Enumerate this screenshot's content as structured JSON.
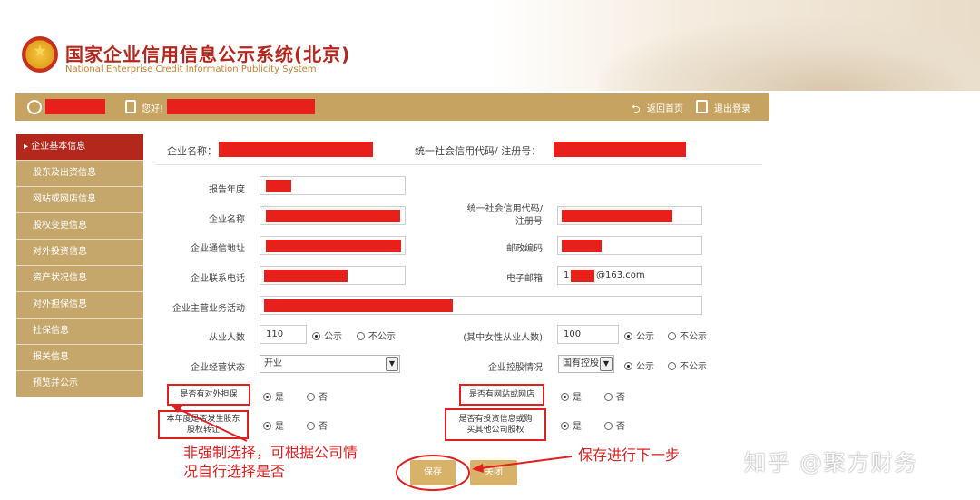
{
  "header": {
    "title": "国家企业信用信息公示系统(北京)",
    "subtitle": "National Enterprise Credit Information Publicity System"
  },
  "toolbar": {
    "greeting": "您好!",
    "back_home": "返回首页",
    "logout": "退出登录"
  },
  "sidebar": {
    "items": [
      {
        "label": "▸ 企业基本信息",
        "active": true
      },
      {
        "label": "股东及出资信息"
      },
      {
        "label": "网站或网店信息"
      },
      {
        "label": "股权变更信息"
      },
      {
        "label": "对外投资信息"
      },
      {
        "label": "资产状况信息"
      },
      {
        "label": "对外担保信息"
      },
      {
        "label": "社保信息"
      },
      {
        "label": "报关信息"
      },
      {
        "label": "预览并公示"
      }
    ]
  },
  "top": {
    "company_name_label": "企业名称：",
    "code_label": "统一社会信用代码/ 注册号："
  },
  "form": {
    "report_year": "报告年度",
    "company_name": "企业名称",
    "code_label_line1": "统一社会信用代码/",
    "code_label_line2": "注册号",
    "address": "企业通信地址",
    "postal": "邮政编码",
    "phone": "企业联系电话",
    "email": "电子邮箱",
    "email_value_prefix": "1",
    "email_value_suffix": "@163.com",
    "business": "企业主营业务活动",
    "employees": "从业人数",
    "employees_value": "110",
    "female": "(其中女性从业人数)",
    "female_value": "100",
    "status": "企业经营状态",
    "status_value": "开业",
    "control": "企业控股情况",
    "control_value": "国有控股",
    "public": "公示",
    "not_public": "不公示",
    "guarantee": "是否有对外担保",
    "website": "是否有网站或网店",
    "transfer_line1": "本年度是否发生股东",
    "transfer_line2": "股权转让",
    "invest_line1": "是否有投资信息或购",
    "invest_line2": "买其他公司股权",
    "yes": "是",
    "no": "否"
  },
  "buttons": {
    "save": "保存",
    "close": "关闭"
  },
  "annotations": {
    "left_line1": "非强制选择，可根据公司情",
    "left_line2": "况自行选择是否",
    "right": "保存进行下一步"
  },
  "watermark": "知乎 @聚方财务",
  "colors": {
    "brand_red": "#b5271c",
    "toolbar_gold": "#c6a361",
    "sidebar_gold": "#c5a76b",
    "redaction": "#e8201c",
    "annotation_red": "#e02020"
  }
}
